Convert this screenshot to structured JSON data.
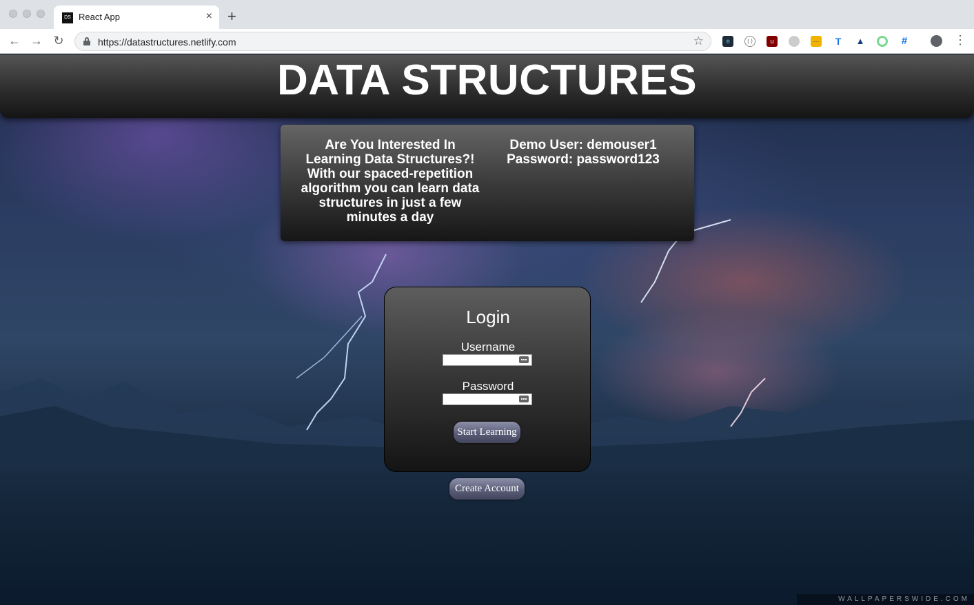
{
  "browser": {
    "tab_title": "React App",
    "favicon_text": "DS",
    "tab_close": "×",
    "new_tab": "+",
    "url": "https://datastructures.netlify.com",
    "nav": {
      "back": "←",
      "forward": "→",
      "reload": "↻"
    },
    "bookmark": "☆",
    "menu": "⋮",
    "extensions": [
      "react-devtools-icon",
      "json-viewer-icon",
      "ublock-icon",
      "privacy-icon",
      "ext-yellow-icon",
      "ext-typography-icon",
      "ext-triangle-icon",
      "ext-ring-icon",
      "grid-icon"
    ]
  },
  "header": {
    "title": "DATA STRUCTURES"
  },
  "info": {
    "intro": "Are You Interested In Learning Data Structures?! With our spaced-repetition algorithm you can learn data structures in just a few minutes a day",
    "demo_user": "Demo User: demouser1",
    "demo_password": "Password: password123"
  },
  "login": {
    "title": "Login",
    "username_label": "Username",
    "username_value": "",
    "password_label": "Password",
    "password_value": "",
    "submit_label": "Start Learning"
  },
  "create_account_label": "Create Account",
  "watermark": "WALLPAPERSWIDE.COM"
}
